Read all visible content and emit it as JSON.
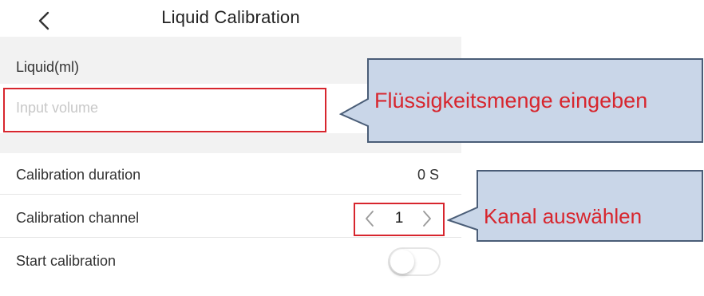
{
  "header": {
    "title": "Liquid Calibration",
    "back_icon": "chevron-left-icon"
  },
  "liquid": {
    "label": "Liquid(ml)",
    "input_value": "",
    "input_placeholder": "Input volume"
  },
  "rows": {
    "duration": {
      "label": "Calibration duration",
      "value": "0 S"
    },
    "channel": {
      "label": "Calibration channel",
      "value": "1"
    },
    "start": {
      "label": "Start calibration",
      "toggle_on": false
    }
  },
  "annotations": {
    "volume_callout": "Flüssigkeitsmenge eingeben",
    "channel_callout": "Kanal auswählen"
  },
  "colors": {
    "highlight": "#d7262e",
    "callout_fill": "#c9d6e8",
    "callout_border": "#4a5d77",
    "section_bg": "#f2f2f2"
  }
}
